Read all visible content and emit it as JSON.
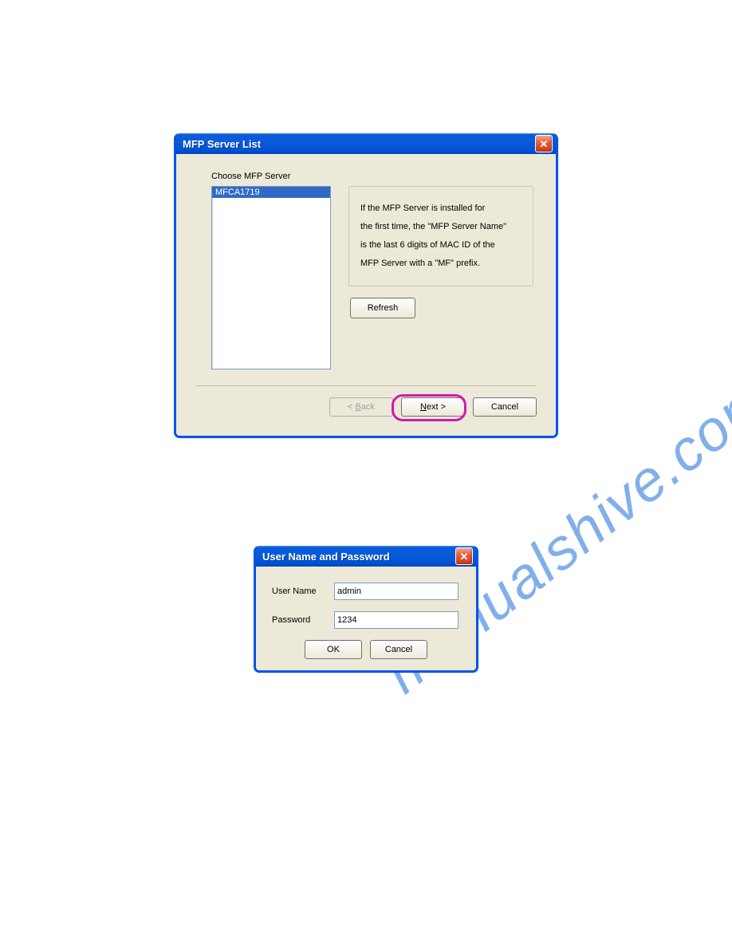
{
  "watermark": "manualshive.com",
  "dialog1": {
    "title": "MFP Server List",
    "choose_label": "Choose MFP Server",
    "list_items": [
      "MFCA1719"
    ],
    "info_lines": [
      "If the MFP Server is installed for",
      "the first time, the \"MFP Server Name\"",
      "is the last 6 digits of MAC ID of the",
      "MFP Server with a \"MF\" prefix."
    ],
    "refresh_label": "Refresh",
    "back_prefix": "< ",
    "back_key": "B",
    "back_rest": "ack",
    "next_key": "N",
    "next_rest": "ext >",
    "cancel_label": "Cancel"
  },
  "dialog2": {
    "title": "User Name and Password",
    "username_label": "User Name",
    "username_value": "admin",
    "password_label": "Password",
    "password_value": "1234",
    "ok_label": "OK",
    "cancel_label": "Cancel"
  }
}
